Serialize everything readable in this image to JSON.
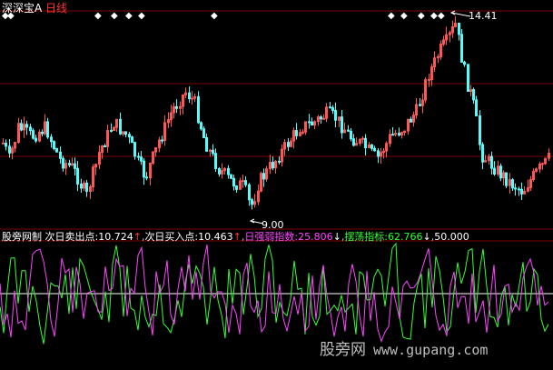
{
  "main": {
    "symbol": "深深宝A",
    "period": "日线",
    "high_label": "14.41",
    "low_label": "9.00"
  },
  "indicator": {
    "name": "股旁网制",
    "sell_label": "次日卖出点:",
    "sell_value": "10.724",
    "sell_arrow": "↑",
    "buy_label": "次日买入点:",
    "buy_value": "10.463",
    "buy_arrow": "↑",
    "strength_label": "日强弱指数:",
    "strength_value": "25.806",
    "strength_arrow": "↓",
    "swing_label": "摆荡指标:",
    "swing_value": "62.766",
    "swing_arrow": "↓",
    "level_value": "50.000"
  },
  "watermark": {
    "brand": "股旁网",
    "url": "www.gupang.com"
  },
  "colors": {
    "up": "#ff5555",
    "down": "#54fcfc",
    "grid": "#800000",
    "green_line": "#33ff33",
    "magenta_line": "#ff44ff",
    "level_line": "#ffffff",
    "header_red": "#ff3333",
    "white": "#ffffff",
    "label_gray": "#c0c0c0"
  }
}
